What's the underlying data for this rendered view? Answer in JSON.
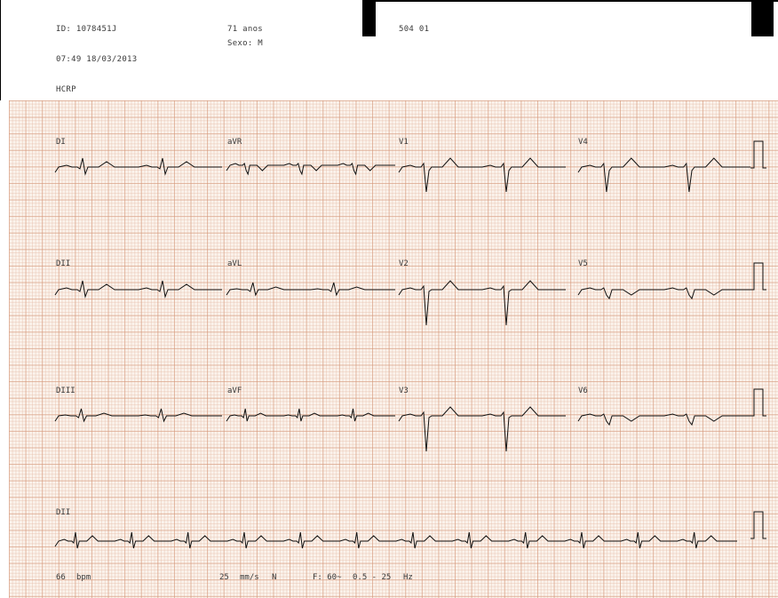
{
  "header": {
    "patient_id": "ID: 1078451J",
    "age": "71 anos",
    "sex": "Sexo: M",
    "code": "504 01",
    "datetime": "07:49 18/03/2013",
    "institution": "HCRP"
  },
  "leads": {
    "row1": [
      "DI",
      "aVR",
      "V1",
      "V4"
    ],
    "row2": [
      "DII",
      "aVL",
      "V2",
      "V5"
    ],
    "row3": [
      "DIII",
      "aVF",
      "V3",
      "V6"
    ],
    "rhythm": "DII"
  },
  "footer": {
    "heart_rate": "66",
    "heart_rate_unit": "bpm",
    "speed": "25",
    "speed_unit": "mm/s",
    "mode": "N",
    "filter": "F: 60~",
    "band": "0.5 - 25",
    "band_unit": "Hz"
  },
  "colors": {
    "grid_major": "#d49678",
    "grid_minor": "#e6beaa",
    "paper": "#fbf3ec",
    "trace": "#000000"
  }
}
